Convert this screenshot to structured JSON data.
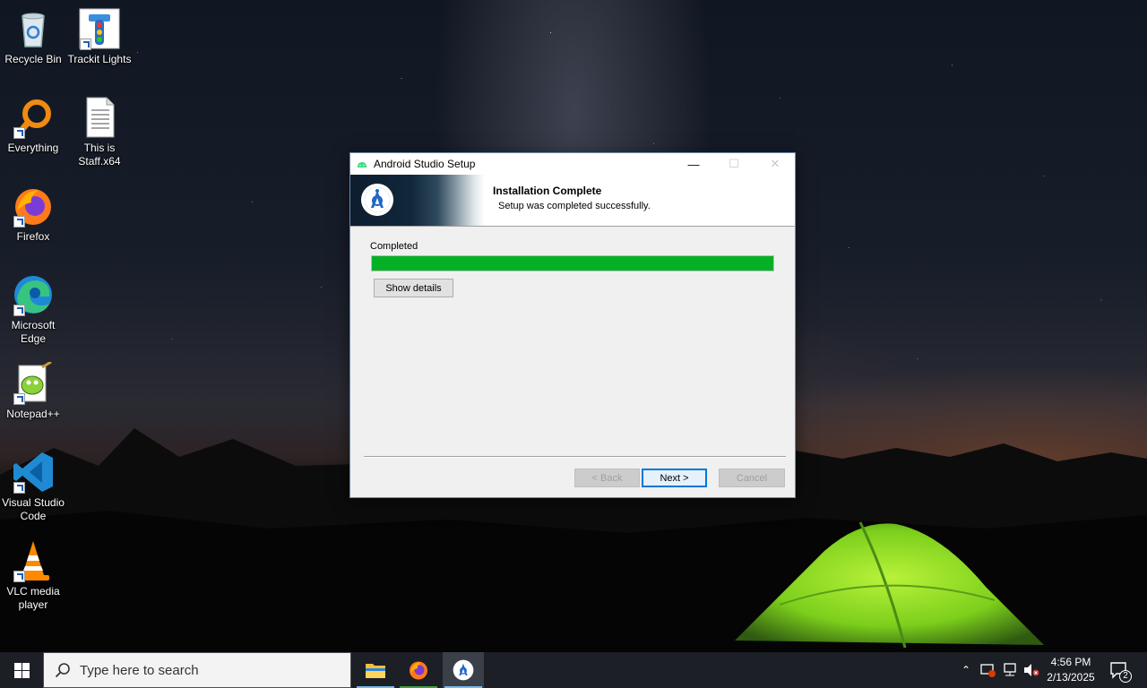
{
  "desktop": {
    "icons": [
      {
        "label": "Recycle Bin",
        "icon": "recycle-bin-icon"
      },
      {
        "label": "Trackit Lights",
        "icon": "traffic-light-icon"
      },
      {
        "label": "Everything",
        "icon": "magnifier-icon"
      },
      {
        "label": "This is Staff.x64",
        "icon": "text-file-icon"
      },
      {
        "label": "Firefox",
        "icon": "firefox-icon"
      },
      {
        "label": "Microsoft Edge",
        "icon": "edge-icon"
      },
      {
        "label": "Notepad++",
        "icon": "notepad-plus-plus-icon"
      },
      {
        "label": "Visual Studio Code",
        "icon": "vscode-icon"
      },
      {
        "label": "VLC media player",
        "icon": "vlc-cone-icon"
      }
    ]
  },
  "setup": {
    "window_title": "Android Studio Setup",
    "header_title": "Installation Complete",
    "header_subtitle": "Setup was completed successfully.",
    "status_label": "Completed",
    "progress": 1.0,
    "progress_color": "#06b025",
    "show_details_label": "Show details",
    "back_label": "< Back",
    "next_label": "Next >",
    "cancel_label": "Cancel"
  },
  "taskbar": {
    "search_placeholder": "Type here to search",
    "time": "4:56 PM",
    "date": "2/13/2025",
    "notification_count": "2",
    "accent": "#76b9ed"
  }
}
